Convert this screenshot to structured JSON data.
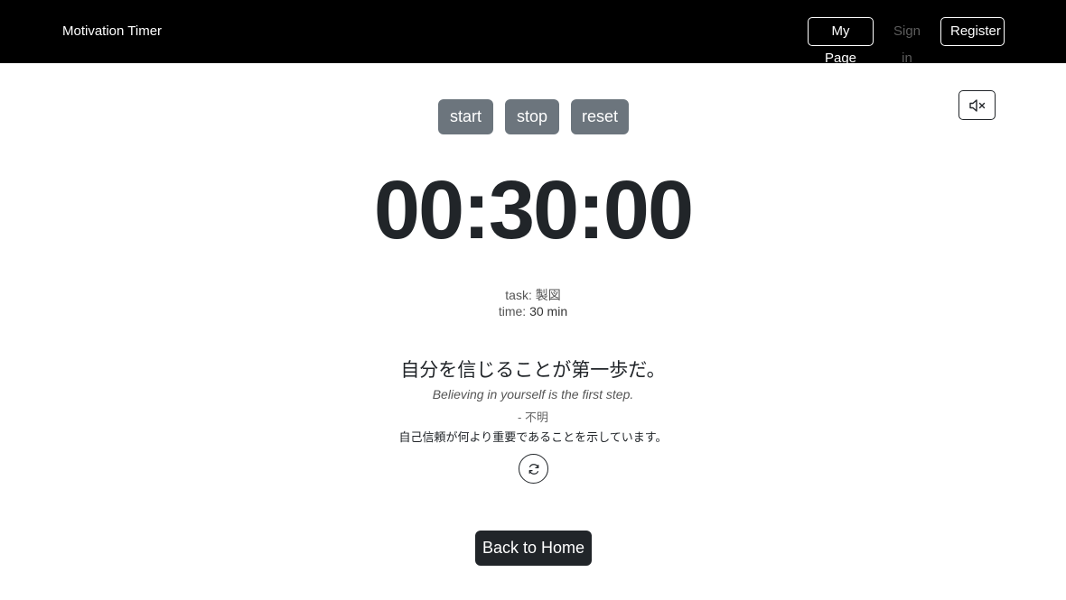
{
  "nav": {
    "brand": "Motivation Timer",
    "my_page": "My Page",
    "sign_in": "Sign in",
    "register": "Register"
  },
  "controls": {
    "start": "start",
    "stop": "stop",
    "reset": "reset",
    "mute_icon": "volume-mute-icon"
  },
  "timer": {
    "display": "00:30:00"
  },
  "task": {
    "task_label": "task:",
    "task_name": "製図",
    "time_label": "time:",
    "time_value": "30 min"
  },
  "quote": {
    "japanese": "自分を信じることが第一歩だ。",
    "english": "Believing in yourself is the first step.",
    "author": "- 不明",
    "description": "自己信頼が何より重要であることを示しています。",
    "refresh_icon": "refresh-icon"
  },
  "footer": {
    "back_home": "Back to Home"
  },
  "colors": {
    "navbar_bg": "#000000",
    "control_button": "#6c757d",
    "home_button": "#212529"
  }
}
